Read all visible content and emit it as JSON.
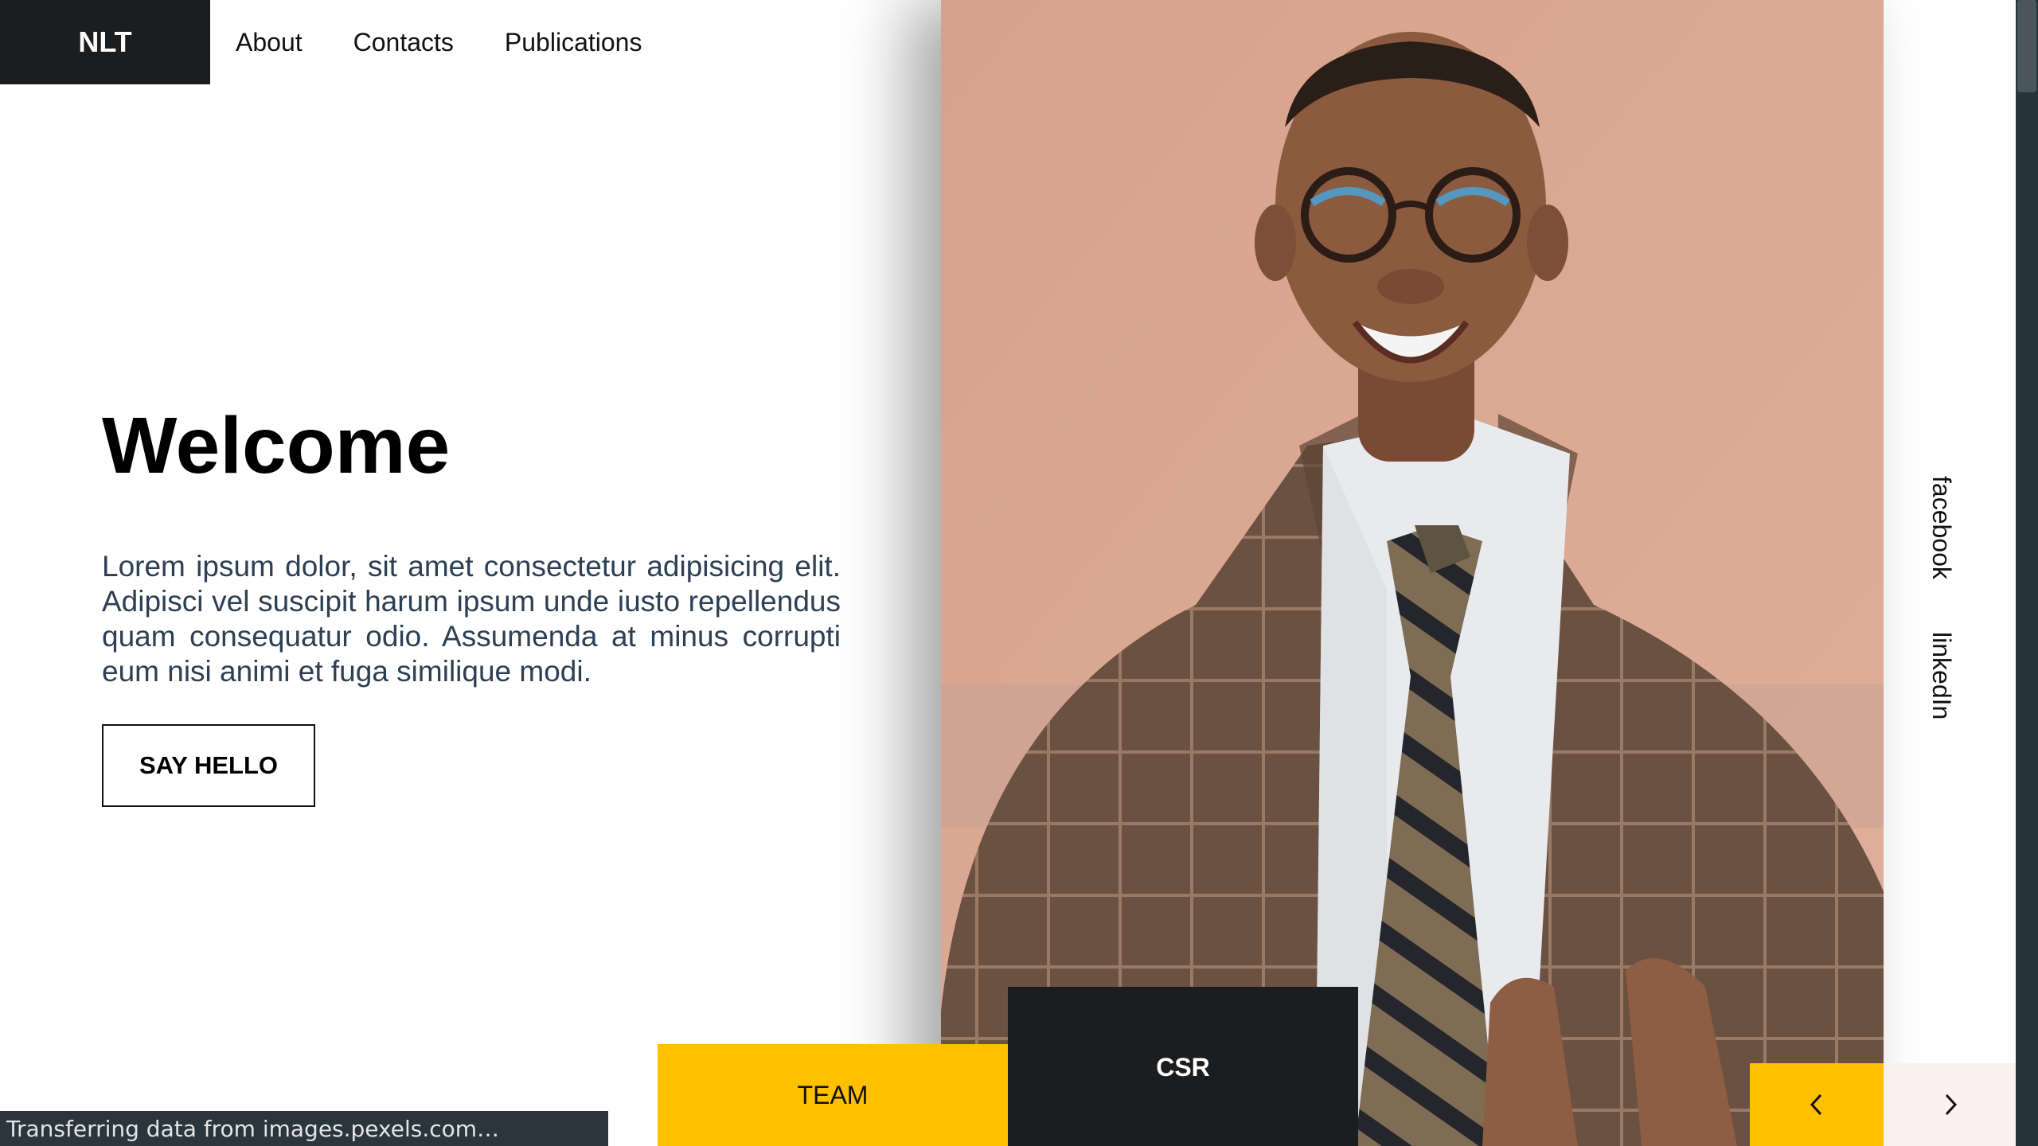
{
  "header": {
    "logo": "NLT",
    "nav": [
      "About",
      "Contacts",
      "Publications"
    ]
  },
  "hero": {
    "title": "Welcome",
    "text": "Lorem ipsum dolor, sit amet consectetur adipisicing elit. Adipisci vel suscipit harum ipsum unde iusto repellendus quam consequatur odio. Assumenda at minus corrupti eum nisi animi et fuga similique modi.",
    "cta": "SAY HELLO"
  },
  "tiles": {
    "team": "TEAM",
    "csr": "CSR"
  },
  "social": [
    "facebook",
    "linkedIn"
  ],
  "slider": {
    "prev_icon": "chevron-left-icon",
    "next_icon": "chevron-right-icon"
  },
  "status_bar": "Transferring data from images.pexels.com…",
  "colors": {
    "accent": "#ffc000",
    "dark": "#1c1d1f",
    "body_text": "#2d3f53",
    "photo_background": "#d9a48d"
  }
}
